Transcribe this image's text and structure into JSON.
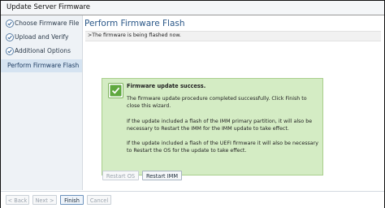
{
  "window": {
    "title": "Update Server Firmware"
  },
  "steps": [
    {
      "label": "Choose Firmware File",
      "status": "complete"
    },
    {
      "label": "Upload and Verify",
      "status": "complete"
    },
    {
      "label": "Additional Options",
      "status": "complete"
    },
    {
      "label": "Perform Firmware Flash",
      "status": "current"
    }
  ],
  "main": {
    "title": "Perform Firmware Flash",
    "description": ">The firmware is being flashed now."
  },
  "notice": {
    "title": "Firmware update success.",
    "paragraphs": [
      "The firmware update procedure completed successfully. Click Finish to close this wizard.",
      "If the update included a flash of the IMM primary partition, it will also be necessary to Restart the IMM for the IMM update to take effect.",
      "If the update included a flash of the UEFI firmware it will also be necessary to Restart the OS for the update to take effect."
    ],
    "icon": "checkmark-icon",
    "background_color": "#d4ecc4"
  },
  "actions": {
    "restart_os": "Restart OS",
    "restart_imm": "Restart IMM"
  },
  "footer": {
    "back": "< Back",
    "next": "Next >",
    "finish": "Finish",
    "cancel": "Cancel"
  }
}
